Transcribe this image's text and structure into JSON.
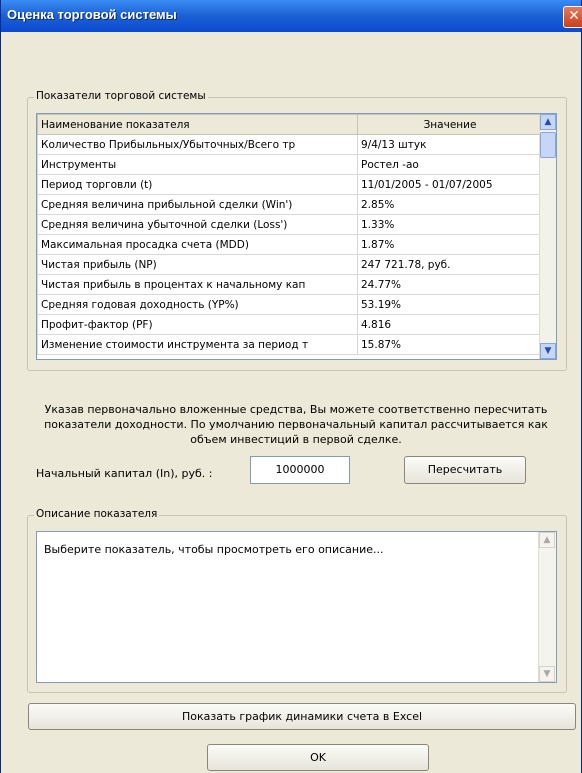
{
  "window": {
    "title": "Оценка торговой системы",
    "close_glyph": "✕"
  },
  "indicators_group": {
    "label": "Показатели торговой системы",
    "columns": [
      "Наименование показателя",
      "Значение"
    ],
    "rows": [
      {
        "name": "Количество Прибыльных/Убыточных/Всего тр",
        "value": "9/4/13 штук"
      },
      {
        "name": "Инструменты",
        "value": "Ростел -ао"
      },
      {
        "name": "Период торговли (t)",
        "value": "11/01/2005 - 01/07/2005"
      },
      {
        "name": "Средняя величина прибыльной сделки (Win')",
        "value": "2.85%"
      },
      {
        "name": "Средняя величина убыточной сделки (Loss')",
        "value": "1.33%"
      },
      {
        "name": "Максимальная просадка счета (MDD)",
        "value": "1.87%"
      },
      {
        "name": "Чистая прибыль (NP)",
        "value": "247 721.78, руб."
      },
      {
        "name": "Чистая прибыль в процентах к начальному кап",
        "value": "24.77%"
      },
      {
        "name": "Средняя годовая доходность (YP%)",
        "value": "53.19%"
      },
      {
        "name": "Профит-фактор (PF)",
        "value": "4.816"
      },
      {
        "name": "Изменение стоимости инструмента за период т",
        "value": "15.87%"
      }
    ]
  },
  "info_text": "Указав первоначально вложенные средства, Вы можете соответственно пересчитать показатели доходности. По умолчанию первоначальный капитал рассчитывается как объем инвестиций в первой сделке.",
  "capital": {
    "label": "Начальный капитал (In), руб. :",
    "value": "1000000",
    "recalc_label": "Пересчитать"
  },
  "description_group": {
    "label": "Описание показателя",
    "text": "Выберите показатель, чтобы просмотреть его описание..."
  },
  "excel_button_label": "Показать график динамики счета в Excel",
  "ok_label": "OK"
}
